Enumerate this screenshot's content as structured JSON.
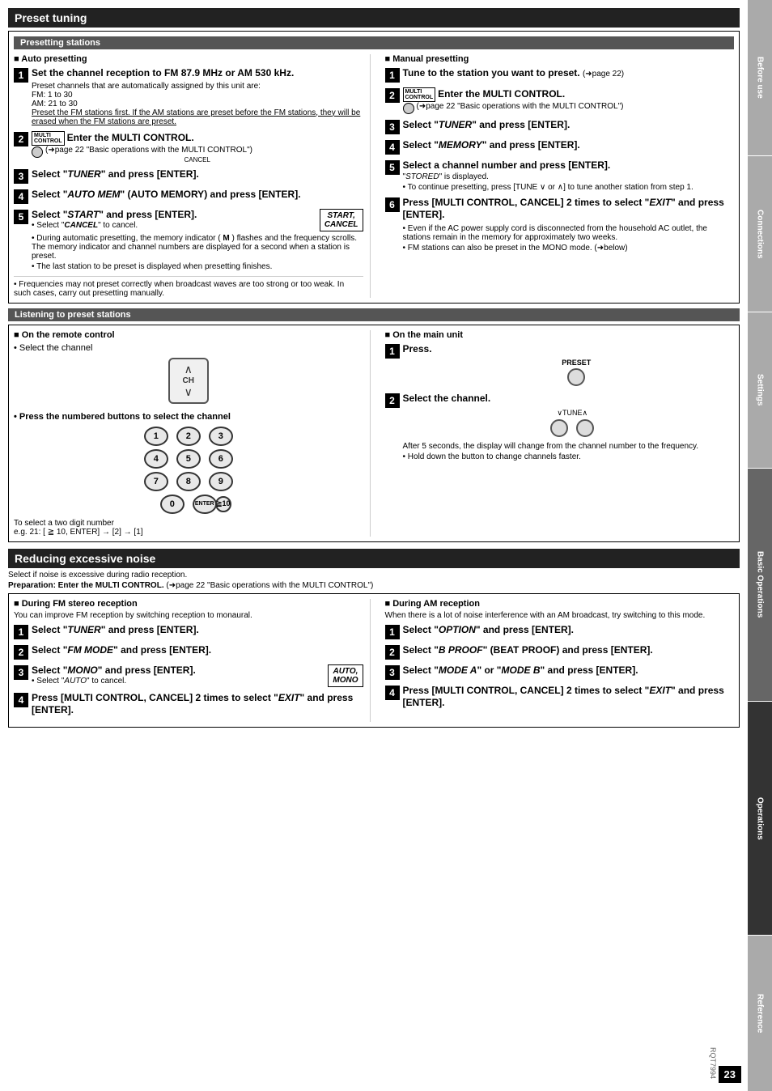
{
  "page": {
    "title": "Preset tuning",
    "page_number": "23",
    "rqt": "RQT7994"
  },
  "tabs": [
    {
      "label": "Before use",
      "class": "tab-before-use"
    },
    {
      "label": "Connections",
      "class": "tab-connections"
    },
    {
      "label": "Settings",
      "class": "tab-settings"
    },
    {
      "label": "Basic Operations",
      "class": "tab-basic-ops"
    },
    {
      "label": "Operations",
      "class": "tab-operations"
    },
    {
      "label": "Reference",
      "class": "tab-reference"
    }
  ],
  "preset_tuning": {
    "header": "Preset tuning",
    "presetting_stations": {
      "header": "Presetting stations",
      "auto_presetting": {
        "title": "■ Auto presetting",
        "steps": [
          {
            "num": "1",
            "title": "Set the channel reception to FM 87.9 MHz or AM 530 kHz.",
            "notes": [
              "Preset channels that are automatically assigned by this unit are:",
              "FM:   1 to 30",
              "AM:  21 to 30",
              "Preset the FM stations first. If the AM stations are preset before the FM stations, they will be erased when the FM stations are preset."
            ]
          },
          {
            "num": "2",
            "title": "Enter the MULTI CONTROL.",
            "sub": "(➜page 22 \"Basic operations with the MULTI CONTROL\")"
          },
          {
            "num": "3",
            "title": "Select \"TUNER\" and press [ENTER]."
          },
          {
            "num": "4",
            "title": "Select \"AUTO MEM\" (AUTO MEMORY) and press [ENTER]."
          },
          {
            "num": "5",
            "title": "Select \"START\" and press [ENTER].",
            "note_bullet": "• Select \"CANCEL\" to cancel.",
            "box_label": "START,\nCANCEL",
            "extra_notes": [
              "• During automatic presetting, the memory indicator ( M ) flashes and the frequency scrolls. The memory indicator and channel numbers are displayed for a second when a station is preset.",
              "• The last station to be preset is displayed when presetting finishes."
            ]
          }
        ],
        "footer_notes": [
          "• Frequencies may not preset correctly when broadcast waves are too strong or too weak. In such cases, carry out presetting manually."
        ]
      },
      "manual_presetting": {
        "title": "■ Manual presetting",
        "steps": [
          {
            "num": "1",
            "title": "Tune to the station you want to preset.",
            "sub": "(➜page 22)"
          },
          {
            "num": "2",
            "title": "Enter the MULTI CONTROL.",
            "sub": "(➜page 22 \"Basic operations with the MULTI CONTROL\")"
          },
          {
            "num": "3",
            "title": "Select \"TUNER\" and press [ENTER]."
          },
          {
            "num": "4",
            "title": "Select \"MEMORY\" and press [ENTER]."
          },
          {
            "num": "5",
            "title": "Select a channel number and press [ENTER].",
            "note1": "\"STORED\" is displayed.",
            "note2": "• To continue presetting, press [TUNE ∨ or ∧] to tune another station from step 1."
          },
          {
            "num": "6",
            "title": "Press [MULTI CONTROL, CANCEL] 2 times to select \"EXIT\" and press [ENTER].",
            "extra_notes": [
              "• Even if the AC power supply cord is disconnected from the household AC outlet, the stations remain in the memory for approximately two weeks.",
              "• FM stations can also be preset in the MONO mode. (➜below)"
            ]
          }
        ]
      }
    },
    "listening_stations": {
      "header": "Listening to preset stations",
      "remote_control": {
        "title": "■ On the remote control",
        "bullet1": "• Select the channel",
        "num_buttons_label": "• Press the numbered buttons to select the channel",
        "two_digit_note": "To select a two digit number",
        "two_digit_example": "e.g. 21: [ ≧ 10, ENTER] → [2] → [1]"
      },
      "main_unit": {
        "title": "■ On the main unit",
        "steps": [
          {
            "num": "1",
            "title": "Press.",
            "label": "PRESET"
          },
          {
            "num": "2",
            "title": "Select the channel.",
            "label": "∨TUNE∧",
            "note": "After 5 seconds, the display will change from the channel number to the frequency.",
            "note2": "• Hold down the button to change channels faster."
          }
        ]
      }
    }
  },
  "reducing_noise": {
    "header": "Reducing excessive noise",
    "intro": "Select if noise is excessive during radio reception.",
    "prep": "Preparation: Enter the MULTI CONTROL.",
    "prep_sub": "(➜page 22 \"Basic operations with the MULTI CONTROL\")",
    "fm_stereo": {
      "title": "■ During FM stereo reception",
      "intro": "You can improve FM reception by switching reception to monaural.",
      "steps": [
        {
          "num": "1",
          "title": "Select \"TUNER\" and press [ENTER]."
        },
        {
          "num": "2",
          "title": "Select \"FM MODE\" and press [ENTER]."
        },
        {
          "num": "3",
          "title": "Select \"MONO\" and press [ENTER].",
          "note": "• Select \"AUTO\" to cancel.",
          "box": "AUTO,\nMONO"
        },
        {
          "num": "4",
          "title": "Press  [MULTI CONTROL, CANCEL] 2 times to select \"EXIT\" and press [ENTER]."
        }
      ]
    },
    "am_reception": {
      "title": "■ During AM reception",
      "intro": "When there is a lot of noise interference with an AM broadcast, try switching to this mode.",
      "steps": [
        {
          "num": "1",
          "title": "Select \"OPTION\" and press [ENTER]."
        },
        {
          "num": "2",
          "title": "Select \"B PROOF\" (BEAT PROOF) and press [ENTER]."
        },
        {
          "num": "3",
          "title": "Select \"MODE A\" or \"MODE B\" and press [ENTER]."
        },
        {
          "num": "4",
          "title": "Press  [MULTI CONTROL, CANCEL] 2 times to select \"EXIT\" and press [ENTER]."
        }
      ]
    }
  }
}
